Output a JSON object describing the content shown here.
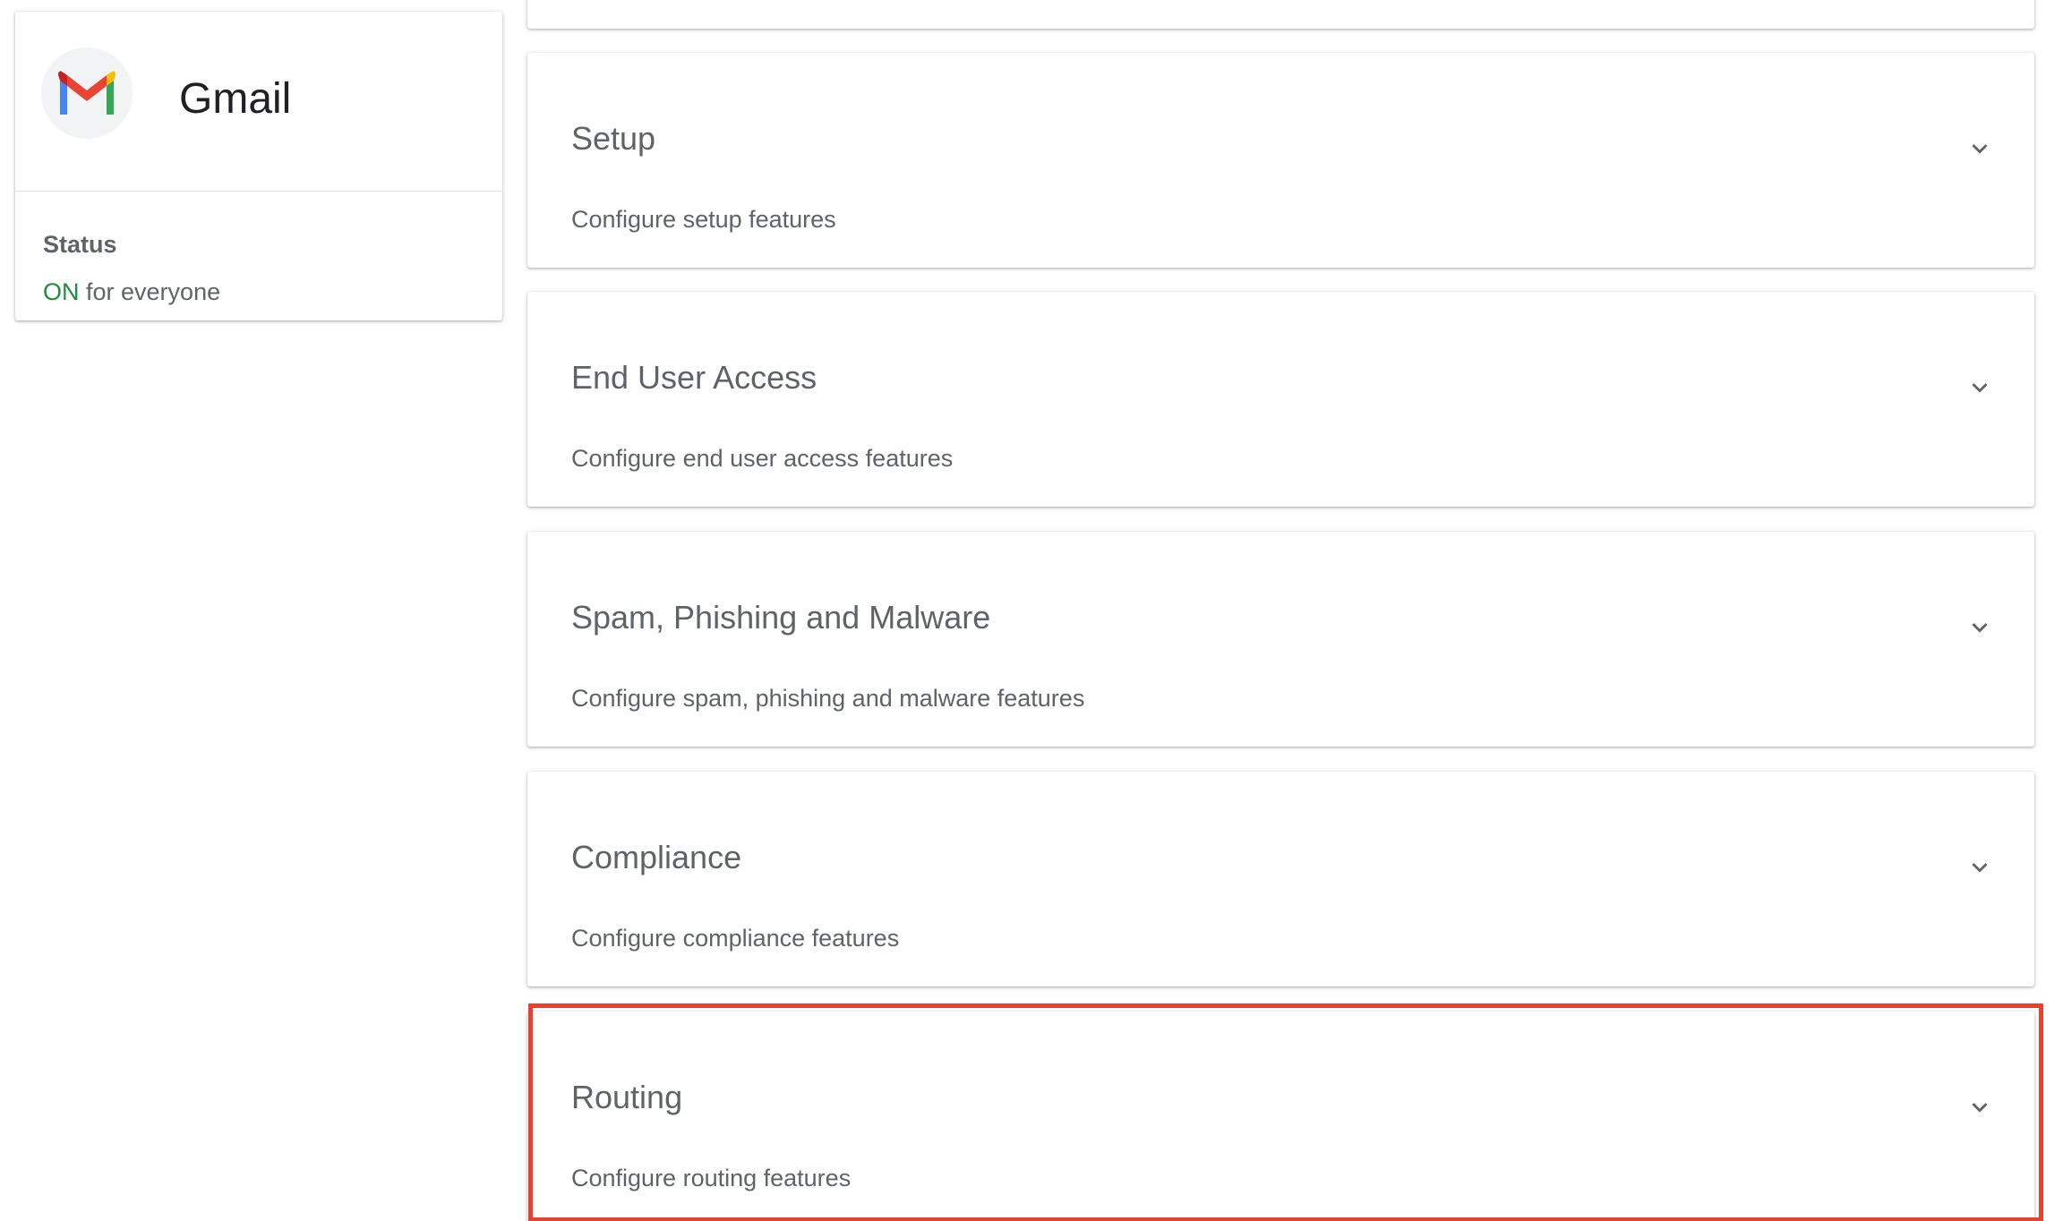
{
  "app": {
    "name": "Gmail",
    "icon": "gmail-logo",
    "status_label": "Status",
    "status_value": "ON",
    "status_suffix": "for everyone",
    "status_color": "#1e8e3e"
  },
  "sections": [
    {
      "title": "Setup",
      "description": "Configure setup features",
      "icon": "chevron-down-icon"
    },
    {
      "title": "End User Access",
      "description": "Configure end user access features",
      "icon": "chevron-down-icon"
    },
    {
      "title": "Spam, Phishing and Malware",
      "description": "Configure spam, phishing and malware features",
      "icon": "chevron-down-icon"
    },
    {
      "title": "Compliance",
      "description": "Configure compliance features",
      "icon": "chevron-down-icon"
    },
    {
      "title": "Routing",
      "description": "Configure routing features",
      "icon": "chevron-down-icon",
      "highlighted": true
    }
  ],
  "highlight_color": "#e8412f"
}
